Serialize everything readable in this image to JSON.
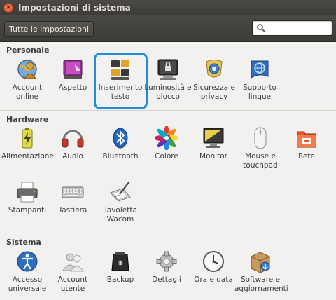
{
  "window": {
    "title": "Impostazioni di sistema"
  },
  "toolbar": {
    "all_settings_label": "Tutte le impostazioni",
    "search_placeholder": ""
  },
  "sections": {
    "personale": {
      "title": "Personale",
      "items": [
        {
          "label": "Account online",
          "icon": "account-online-icon"
        },
        {
          "label": "Aspetto",
          "icon": "appearance-icon"
        },
        {
          "label": "Inserimento testo",
          "icon": "text-entry-icon",
          "selected": true
        },
        {
          "label": "Luminosità e blocco",
          "icon": "brightness-lock-icon"
        },
        {
          "label": "Sicurezza e privacy",
          "icon": "security-privacy-icon"
        },
        {
          "label": "Supporto lingue",
          "icon": "language-support-icon"
        }
      ]
    },
    "hardware": {
      "title": "Hardware",
      "items": [
        {
          "label": "Alimentazione",
          "icon": "power-icon"
        },
        {
          "label": "Audio",
          "icon": "audio-icon"
        },
        {
          "label": "Bluetooth",
          "icon": "bluetooth-icon"
        },
        {
          "label": "Colore",
          "icon": "color-icon"
        },
        {
          "label": "Monitor",
          "icon": "monitor-icon"
        },
        {
          "label": "Mouse e touchpad",
          "icon": "mouse-icon"
        },
        {
          "label": "Rete",
          "icon": "network-icon"
        },
        {
          "label": "Stampanti",
          "icon": "printer-icon"
        },
        {
          "label": "Tastiera",
          "icon": "keyboard-icon"
        },
        {
          "label": "Tavoletta Wacom",
          "icon": "wacom-tablet-icon"
        }
      ]
    },
    "sistema": {
      "title": "Sistema",
      "items": [
        {
          "label": "Accesso universale",
          "icon": "universal-access-icon"
        },
        {
          "label": "Account utente",
          "icon": "user-accounts-icon"
        },
        {
          "label": "Backup",
          "icon": "backup-icon"
        },
        {
          "label": "Dettagli",
          "icon": "details-icon"
        },
        {
          "label": "Ora e data",
          "icon": "clock-icon"
        },
        {
          "label": "Software e aggiornamenti",
          "icon": "software-updates-icon"
        }
      ]
    }
  },
  "colors": {
    "selection": "#1e8fd6",
    "toolbar": "#3c3b37",
    "background": "#f2f1f0"
  }
}
